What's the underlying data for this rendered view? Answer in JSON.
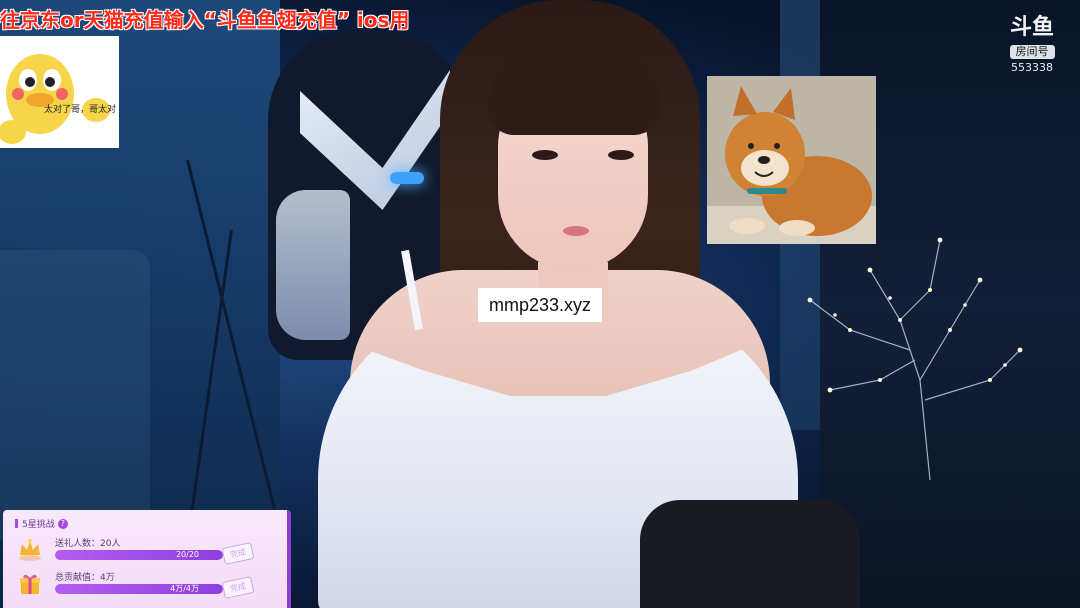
{
  "banner": {
    "text": "往京东or天猫充值输入“斗鱼鱼翅充值” ios用",
    "color": "#ff2a1a"
  },
  "duck_sticker": {
    "caption": "太对了哥，哥太对"
  },
  "platform_logo": {
    "name": "斗鱼",
    "tag": "房间号",
    "room_number": "553338"
  },
  "watermark": {
    "text": "mmp233.xyz"
  },
  "challenge_panel": {
    "title": "5星挑战",
    "help_icon": "?",
    "accent_color": "#a14be0",
    "tasks": [
      {
        "icon": "crown-icon",
        "label": "送礼人数：20人",
        "progress_text": "20/20",
        "progress_fraction": 1.0,
        "status": "完成"
      },
      {
        "icon": "gift-box-icon",
        "label": "总贡献值：4万",
        "progress_text": "4万/4万",
        "progress_fraction": 1.0,
        "status": "完成"
      }
    ]
  }
}
